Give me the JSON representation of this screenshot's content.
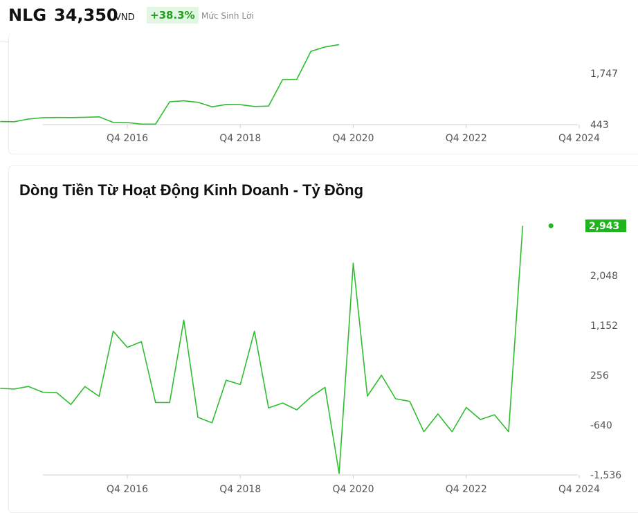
{
  "header": {
    "ticker": "NLG",
    "price": "34,350",
    "currency": "VND",
    "change": "+38.3%",
    "change_label": "Mức Sinh Lời"
  },
  "colors": {
    "line": "#2ebd2e",
    "accent": "#1fb51f",
    "positive_bg": "#e3f6e3"
  },
  "chart_data": [
    {
      "type": "line",
      "title": "",
      "x_tick_labels": [
        "Q4 2016",
        "Q4 2018",
        "Q4 2020",
        "Q4 2022",
        "Q4 2024"
      ],
      "y_tick_labels": [
        "1,747",
        "443"
      ],
      "ylim": [
        443,
        2400
      ],
      "x": [
        2014.5,
        2014.75,
        2015.0,
        2015.25,
        2015.5,
        2015.75,
        2016.0,
        2016.25,
        2016.5,
        2016.75,
        2017.0,
        2017.25,
        2017.5,
        2017.75,
        2018.0,
        2018.25,
        2018.5,
        2018.75,
        2019.0,
        2019.25,
        2019.5,
        2019.75,
        2020.0,
        2020.25,
        2020.5
      ],
      "values": [
        520,
        517,
        585,
        620,
        625,
        622,
        630,
        640,
        500,
        495,
        455,
        455,
        1025,
        1050,
        1010,
        895,
        955,
        950,
        905,
        915,
        1590,
        1595,
        2310,
        2420,
        2480
      ]
    },
    {
      "type": "line",
      "title": "Dòng Tiền Từ Hoạt Động Kinh Doanh - Tỷ Đồng",
      "x_tick_labels": [
        "Q4 2016",
        "Q4 2018",
        "Q4 2020",
        "Q4 2022",
        "Q4 2024"
      ],
      "y_tick_labels": [
        "2,048",
        "1,152",
        "256",
        "-640",
        "-1,536"
      ],
      "ylim": [
        -1536,
        2943
      ],
      "last_value_label": "2,943",
      "x": [
        2014.5,
        2014.75,
        2015.0,
        2015.25,
        2015.5,
        2015.75,
        2016.0,
        2016.25,
        2016.5,
        2016.75,
        2017.0,
        2017.25,
        2017.5,
        2017.75,
        2018.0,
        2018.25,
        2018.5,
        2018.75,
        2019.0,
        2019.25,
        2019.5,
        2019.75,
        2020.0,
        2020.25,
        2020.5,
        2020.75,
        2021.0,
        2021.25,
        2021.5,
        2021.75,
        2022.0,
        2022.25,
        2022.5,
        2022.75,
        2023.0,
        2023.25,
        2023.5,
        2023.75,
        2024.0,
        2024.25
      ],
      "values": [
        19,
        8,
        54,
        -49,
        -57,
        -270,
        53,
        -123,
        1047,
        758,
        860,
        -234,
        -234,
        1246,
        -500,
        -600,
        166,
        89,
        1047,
        -333,
        -243,
        -366,
        -134,
        37,
        -1510,
        2270,
        -120,
        256,
        -167,
        -213,
        -760,
        -440,
        -760,
        -323,
        -540,
        -454,
        -760,
        2943
      ]
    }
  ]
}
